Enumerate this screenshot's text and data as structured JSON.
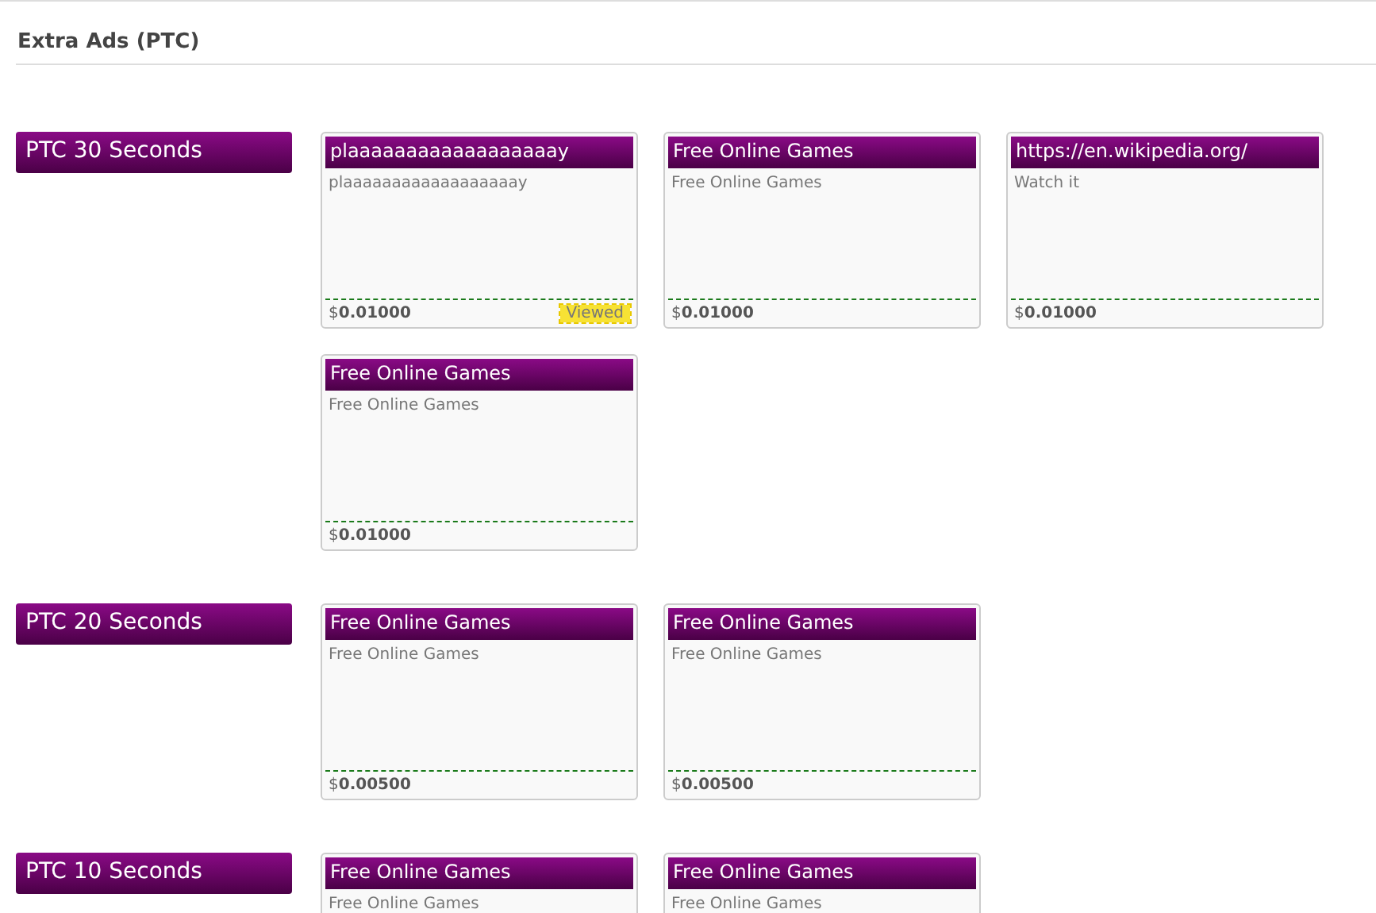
{
  "page_title": "Extra Ads (PTC)",
  "sections": [
    {
      "label": "PTC 30 Seconds",
      "ads": [
        {
          "title": "plaaaaaaaaaaaaaaaaaay",
          "description": "plaaaaaaaaaaaaaaaaaay",
          "price": "$**0.01000**",
          "status": "Viewed"
        },
        {
          "title": "Free Online Games",
          "description": "Free Online Games",
          "price": "$**0.01000**"
        },
        {
          "title": "https://en.wikipedia.org/",
          "description": "Watch it",
          "price": "$**0.01000**"
        },
        {
          "title": "Free Online Games",
          "description": "Free Online Games",
          "price": "$**0.01000**"
        }
      ]
    },
    {
      "label": "PTC 20 Seconds",
      "ads": [
        {
          "title": "Free Online Games",
          "description": "Free Online Games",
          "price": "$**0.00500**"
        },
        {
          "title": "Free Online Games",
          "description": "Free Online Games",
          "price": "$**0.00500**"
        }
      ]
    },
    {
      "label": "PTC 10 Seconds",
      "ads": [
        {
          "title": "Free Online Games",
          "description": "Free Online Games"
        },
        {
          "title": "Free Online Games",
          "description": "Free Online Games"
        }
      ]
    }
  ]
}
